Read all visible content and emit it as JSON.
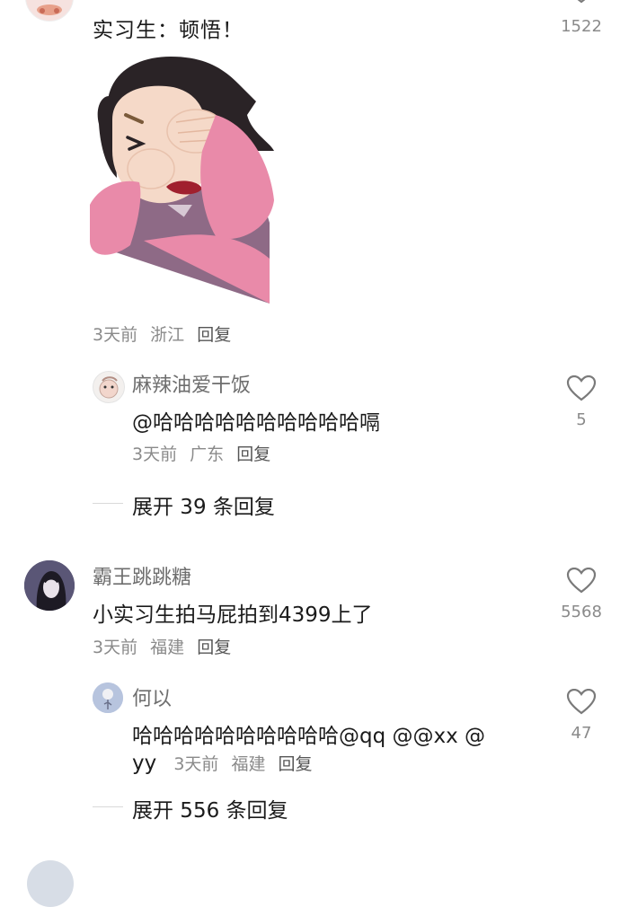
{
  "colors": {
    "text_primary": "#1b1b1b",
    "text_secondary": "#8a8a8a",
    "name_gray": "#6e6e6e",
    "shirt_pink": "#e98aa9",
    "hair_black": "#2a2326"
  },
  "comments": [
    {
      "name": "",
      "text": "实习生：顿悟！",
      "likes": "1522",
      "sticker": "facepalm-girl-sticker",
      "meta": {
        "time": "3天前",
        "location": "浙江",
        "reply": "回复"
      },
      "replies": [
        {
          "name": "麻辣油爱干饭",
          "text": "@哈哈哈哈哈哈哈哈哈哈嗝",
          "likes": "5",
          "meta": {
            "time": "3天前",
            "location": "广东",
            "reply": "回复"
          }
        }
      ],
      "expand_label": "展开 39 条回复"
    },
    {
      "name": "霸王跳跳糖",
      "text": "小实习生拍马屁拍到4399上了",
      "likes": "5568",
      "meta": {
        "time": "3天前",
        "location": "福建",
        "reply": "回复"
      },
      "replies": [
        {
          "name": "何以",
          "text_line1": "哈哈哈哈哈哈哈哈哈哈@qq  @@xx  @",
          "text_line2": "yy",
          "likes": "47",
          "meta": {
            "time": "3天前",
            "location": "福建",
            "reply": "回复"
          }
        }
      ],
      "expand_label": "展开 556 条回复"
    }
  ]
}
